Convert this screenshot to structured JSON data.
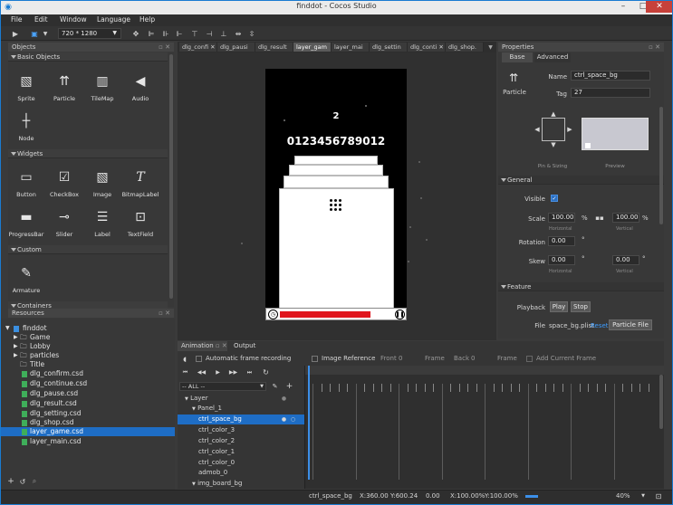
{
  "window": {
    "title": "finddot - Cocos Studio",
    "minimize": "–",
    "maximize": "□",
    "close": "✕"
  },
  "menu": [
    "File",
    "Edit",
    "Window",
    "Language",
    "Help"
  ],
  "toolbar": {
    "resolution": "720 * 1280"
  },
  "objects_panel": {
    "title": "Objects",
    "sections": {
      "basic": "Basic Objects",
      "widgets": "Widgets",
      "custom": "Custom",
      "containers": "Containers"
    },
    "basic_items": [
      "Sprite",
      "Particle",
      "TileMap",
      "Audio",
      "Node"
    ],
    "widget_items": [
      "Button",
      "CheckBox",
      "Image",
      "BitmapLabel",
      "ProgressBar",
      "Slider",
      "Label",
      "TextField"
    ],
    "custom_items": [
      "Armature"
    ]
  },
  "resources_panel": {
    "title": "Resources",
    "project": "finddot",
    "folders": [
      "Game",
      "Lobby",
      "particles",
      "Title"
    ],
    "files": [
      "dlg_confirm.csd",
      "dlg_continue.csd",
      "dlg_pause.csd",
      "dlg_result.csd",
      "dlg_setting.csd",
      "dlg_shop.csd",
      "layer_game.csd",
      "layer_main.csd"
    ]
  },
  "tabs": [
    "dlg_confi",
    "dlg_pausi",
    "dlg_result",
    "layer_gam",
    "layer_mai",
    "dlg_settin",
    "dlg_conti",
    "dlg_shop."
  ],
  "canvas": {
    "level": "2",
    "score": "0123456789012"
  },
  "properties": {
    "title": "Properties",
    "tabs": [
      "Base",
      "Advanced"
    ],
    "type_label": "Particle",
    "name_label": "Name",
    "name_value": "ctrl_space_bg",
    "tag_label": "Tag",
    "tag_value": "27",
    "pin_label": "Pin & Sizing",
    "preview_label": "Preview",
    "general": "General",
    "visible_label": "Visible",
    "scale_label": "Scale",
    "scale_h": "100.00",
    "scale_v": "100.00",
    "percent": "%",
    "horizontal": "Horizontal",
    "vertical": "Vertical",
    "rotation_label": "Rotation",
    "rotation": "0.00",
    "degree": "°",
    "skew_label": "Skew",
    "skew_h": "0.00",
    "skew_v": "0.00",
    "feature": "Feature",
    "playback_label": "Playback",
    "play": "Play",
    "stop": "Stop",
    "file_label": "File",
    "file_value": "space_bg.plist",
    "reset": "Reset",
    "particle_file": "Particle File"
  },
  "animation": {
    "tabs": [
      "Animation",
      "Output"
    ],
    "auto_record": "Automatic frame recording",
    "image_ref": "Image Reference",
    "front": "Front",
    "front_val": "0",
    "frame": "Frame",
    "back": "Back",
    "back_val": "0",
    "frame2": "Frame",
    "add_frame": "Add Current Frame",
    "filter": "-- ALL --",
    "rows": [
      "Layer",
      "Panel_1",
      "ctrl_space_bg",
      "ctrl_color_3",
      "ctrl_color_2",
      "ctrl_color_1",
      "ctrl_color_0",
      "admob_0",
      "img_board_bg"
    ]
  },
  "status": {
    "node": "ctrl_space_bg",
    "x": "X:360.00",
    "y": "Y:600.24",
    "rot": "0.00",
    "sx": "X:100.00%",
    "sy": "Y:100.00%",
    "zoom": "40%"
  }
}
